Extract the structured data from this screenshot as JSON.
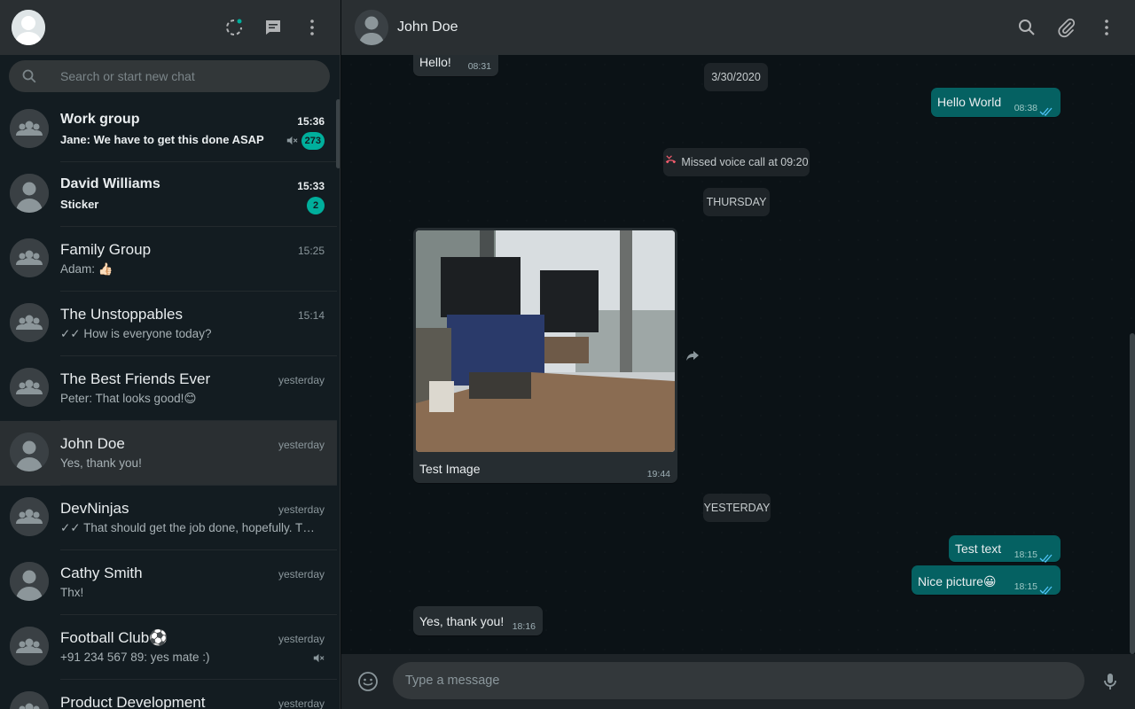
{
  "sidebar": {
    "search": {
      "placeholder": "Search or start new chat"
    },
    "chats": [
      {
        "name": "Work group",
        "time": "15:36",
        "preview": "Jane: We have to get this done ASAP",
        "unread": "273",
        "muted": true,
        "group": true,
        "unread_style": true
      },
      {
        "name": "David Williams",
        "time": "15:33",
        "preview": "Sticker",
        "unread": "2",
        "muted": false,
        "group": false,
        "unread_style": true
      },
      {
        "name": "Family Group",
        "time": "15:25",
        "preview": "Adam: 👍🏻",
        "group": true
      },
      {
        "name": "The Unstoppables",
        "time": "15:14",
        "preview": "✓✓ How is everyone today?",
        "group": true
      },
      {
        "name": "The Best Friends Ever",
        "time": "yesterday",
        "preview": "Peter: That looks good!😊",
        "group": true
      },
      {
        "name": "John Doe",
        "time": "yesterday",
        "preview": "Yes, thank you!",
        "group": false,
        "active": true
      },
      {
        "name": "DevNinjas",
        "time": "yesterday",
        "preview": "✓✓ That should get the job done, hopefully. The ne...",
        "group": true
      },
      {
        "name": "Cathy Smith",
        "time": "yesterday",
        "preview": "Thx!",
        "group": false
      },
      {
        "name": "Football Club⚽",
        "time": "yesterday",
        "preview": "+91 234 567 89: yes mate :)",
        "muted": true,
        "group": true
      },
      {
        "name": "Product Development",
        "time": "yesterday",
        "preview": "",
        "group": true
      }
    ]
  },
  "conversation": {
    "title": "John Doe",
    "messages": {
      "m1": {
        "text": "Hello!",
        "time": "08:31"
      },
      "d1": {
        "text": "3/30/2020"
      },
      "m2": {
        "text": "Hello World",
        "time": "08:38"
      },
      "call": {
        "text": "Missed voice call at 09:20"
      },
      "d2": {
        "text": "THURSDAY"
      },
      "m3": {
        "text": "Test Image",
        "time": "19:44"
      },
      "d3": {
        "text": "YESTERDAY"
      },
      "m4": {
        "text": "Test text",
        "time": "18:15"
      },
      "m5": {
        "text": "Nice picture😀",
        "time": "18:15"
      },
      "m6": {
        "text": "Yes, thank you!",
        "time": "18:16"
      }
    }
  },
  "composer": {
    "placeholder": "Type a message"
  },
  "colors": {
    "accent": "#00af9c",
    "outgoing": "#056162",
    "incoming": "#262d31",
    "ticks": "#4fc3f7"
  }
}
